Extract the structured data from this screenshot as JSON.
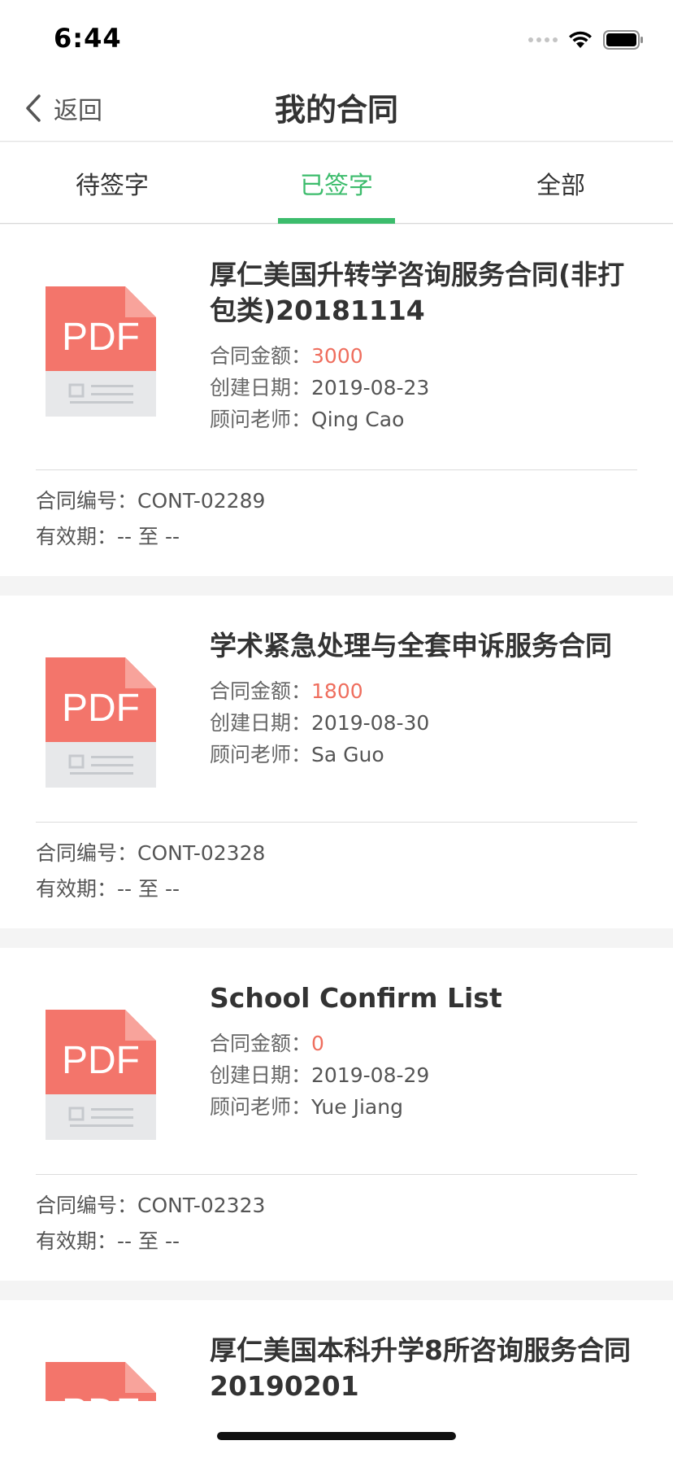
{
  "status_bar": {
    "time": "6:44"
  },
  "nav": {
    "back_label": "返回",
    "title": "我的合同"
  },
  "tabs": [
    {
      "label": "待签字",
      "active": false
    },
    {
      "label": "已签字",
      "active": true
    },
    {
      "label": "全部",
      "active": false
    }
  ],
  "labels": {
    "amount": "合同金额：",
    "created": "创建日期：",
    "advisor": "顾问老师：",
    "number": "合同编号：",
    "validity": "有效期："
  },
  "pdf_icon": {
    "text": "PDF",
    "color": "#f3756b"
  },
  "contracts": [
    {
      "title": "厚仁美国升转学咨询服务合同(非打包类)20181114",
      "amount": "3000",
      "created": "2019-08-23",
      "advisor": "Qing Cao",
      "number": "CONT-02289",
      "validity": "--  至 --"
    },
    {
      "title": "学术紧急处理与全套申诉服务合同",
      "amount": "1800",
      "created": "2019-08-30",
      "advisor": "Sa Guo",
      "number": "CONT-02328",
      "validity": "--  至 --"
    },
    {
      "title": "School Confirm List",
      "amount": "0",
      "created": "2019-08-29",
      "advisor": "Yue Jiang",
      "number": "CONT-02323",
      "validity": "--  至 --"
    },
    {
      "title": "厚仁美国本科升学8所咨询服务合同20190201"
    }
  ],
  "colors": {
    "accent": "#3cbc6c",
    "amount": "#ef6e5e"
  }
}
